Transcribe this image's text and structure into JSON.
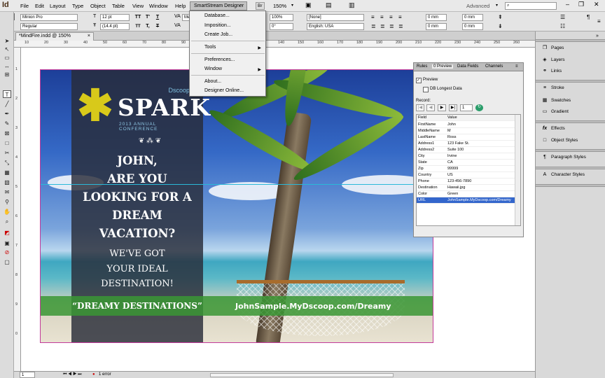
{
  "app": {
    "logo": "Id"
  },
  "menu": [
    "File",
    "Edit",
    "Layout",
    "Type",
    "Object",
    "Table",
    "View",
    "Window",
    "Help"
  ],
  "smartstream_menu": {
    "title": "SmartStream Designer",
    "items": [
      {
        "label": "Database...",
        "submenu": false
      },
      {
        "label": "Imposition...",
        "submenu": false
      },
      {
        "label": "Create Job...",
        "submenu": false
      },
      {
        "label": "Tools",
        "submenu": true
      },
      {
        "label": "Preferences...",
        "submenu": false
      },
      {
        "label": "Window",
        "submenu": true
      },
      {
        "label": "About...",
        "submenu": false
      },
      {
        "label": "Designer Online...",
        "submenu": false
      }
    ]
  },
  "menubar_right": {
    "br": "Br",
    "zoom": "150%",
    "workspace": "Advanced",
    "search_placeholder": "",
    "search_icon": "search-icon"
  },
  "control": {
    "font": "Minion Pro",
    "style": "Regular",
    "size": "12 pt",
    "leading": "(14.4 pt)",
    "tracking": "Met",
    "scale_h": "100%",
    "skew": "0°",
    "char_style": "[None]",
    "language": "English: USA",
    "indent1": "0 mm",
    "indent2": "0 mm",
    "indent3": "0 mm",
    "indent4": "0 mm",
    "t_buttons": [
      "TT",
      "T'",
      "T,",
      "T",
      "T",
      "T"
    ]
  },
  "document": {
    "tab": "*MindFire.indd @ 150%",
    "close": "×"
  },
  "ruler_h": [
    "10",
    "20",
    "30",
    "40",
    "50",
    "60",
    "70",
    "80",
    "90",
    "100",
    "110",
    "120",
    "130",
    "140",
    "150",
    "160",
    "170",
    "180",
    "190",
    "200",
    "210",
    "220",
    "230",
    "240",
    "250",
    "260"
  ],
  "ruler_v": [
    "1",
    "2",
    "3",
    "4",
    "5",
    "6",
    "7",
    "8",
    "9",
    "0"
  ],
  "artwork": {
    "logo_top": "Dscoop8",
    "logo_word": "SPARK",
    "logo_sub": "2013 ANNUAL CONFERENCE",
    "ornament": "❦ ⁂ ❦",
    "headline": [
      "JOHN,",
      "ARE YOU",
      "LOOKING FOR A",
      "DREAM",
      "VACATION?"
    ],
    "subhead": [
      "WE'VE GOT",
      "YOUR IDEAL",
      "DESTINATION!"
    ],
    "tagline": "“DREAMY DESTINATIONS”",
    "url": "JohnSample.MyDscoop.com/Dreamy"
  },
  "data_panel": {
    "tabs": [
      "Rules",
      "0 Preview",
      "Data Fields",
      "Channels"
    ],
    "preview_label": "Preview",
    "longest_label": "DB Longest Data",
    "record_label": "Record:",
    "record_value": "1",
    "col_field": "Field",
    "col_value": "Value",
    "rows": [
      {
        "field": "FirstName",
        "value": "John"
      },
      {
        "field": "MiddleName",
        "value": "M"
      },
      {
        "field": "LastName",
        "value": "Ross"
      },
      {
        "field": "Address1",
        "value": "123 Fake St."
      },
      {
        "field": "Address2",
        "value": "Suite 100"
      },
      {
        "field": "City",
        "value": "Irvine"
      },
      {
        "field": "State",
        "value": "CA"
      },
      {
        "field": "Zip",
        "value": "99999"
      },
      {
        "field": "Country",
        "value": "US"
      },
      {
        "field": "Phone",
        "value": "123-456-7890"
      },
      {
        "field": "Destination",
        "value": "Hawaii.jpg"
      },
      {
        "field": "Color",
        "value": "Green"
      },
      {
        "field": "URL",
        "value": "JohnSample.MyDscoop.com/Dreamy"
      }
    ]
  },
  "dock": {
    "group1": [
      {
        "label": "Pages",
        "icon": "pages-icon"
      },
      {
        "label": "Layers",
        "icon": "layers-icon"
      },
      {
        "label": "Links",
        "icon": "links-icon"
      }
    ],
    "group2": [
      {
        "label": "Stroke",
        "icon": "stroke-icon"
      },
      {
        "label": "Swatches",
        "icon": "swatches-icon"
      },
      {
        "label": "Gradient",
        "icon": "gradient-icon"
      }
    ],
    "group3": [
      {
        "label": "Effects",
        "icon": "effects-icon"
      },
      {
        "label": "Object Styles",
        "icon": "object-styles-icon"
      }
    ],
    "group4": [
      {
        "label": "Paragraph Styles",
        "icon": "paragraph-styles-icon"
      }
    ],
    "group5": [
      {
        "label": "Character Styles",
        "icon": "character-styles-icon"
      }
    ]
  },
  "status": {
    "page": "1",
    "errors": "1 error"
  }
}
